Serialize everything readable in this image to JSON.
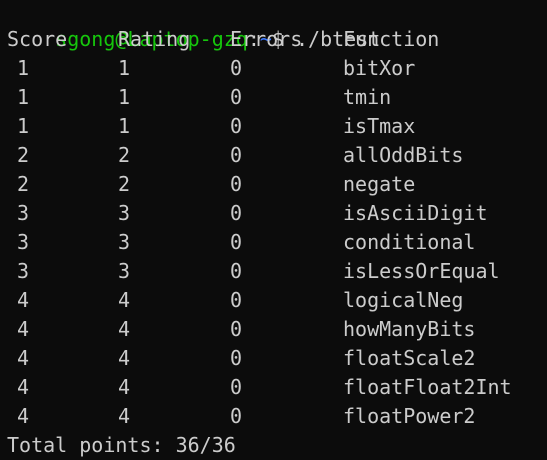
{
  "prompt": {
    "user_host": "sgong@Laptop-gzq",
    "separator": ":",
    "path": "~",
    "dollar": "$",
    "command": " ./btest"
  },
  "table": {
    "headers": [
      "Score",
      "Rating",
      "Errors",
      "Function"
    ],
    "rows": [
      [
        "1",
        "1",
        "0",
        "bitXor"
      ],
      [
        "1",
        "1",
        "0",
        "tmin"
      ],
      [
        "1",
        "1",
        "0",
        "isTmax"
      ],
      [
        "2",
        "2",
        "0",
        "allOddBits"
      ],
      [
        "2",
        "2",
        "0",
        "negate"
      ],
      [
        "3",
        "3",
        "0",
        "isAsciiDigit"
      ],
      [
        "3",
        "3",
        "0",
        "conditional"
      ],
      [
        "3",
        "3",
        "0",
        "isLessOrEqual"
      ],
      [
        "4",
        "4",
        "0",
        "logicalNeg"
      ],
      [
        "4",
        "4",
        "0",
        "howManyBits"
      ],
      [
        "4",
        "4",
        "0",
        "floatScale2"
      ],
      [
        "4",
        "4",
        "0",
        "floatFloat2Int"
      ],
      [
        "4",
        "4",
        "0",
        "floatPower2"
      ]
    ]
  },
  "total": "Total points: 36/36",
  "colors": {
    "background": "#0c0c0c",
    "text": "#cccccc",
    "user_host": "#16c60c",
    "path": "#3b78ff"
  }
}
